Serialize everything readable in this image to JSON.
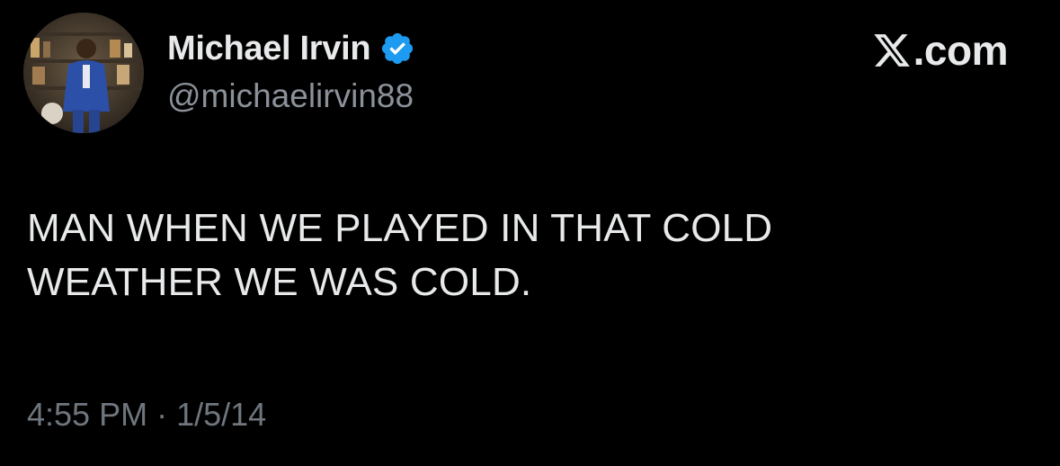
{
  "author": {
    "display_name": "Michael Irvin",
    "handle": "@michaelirvin88",
    "verified": true,
    "avatar_icon": "profile-photo-avatar"
  },
  "brand": {
    "icon": "x-logo-icon",
    "text": ".com"
  },
  "tweet": {
    "lines": [
      "MAN WHEN WE PLAYED IN THAT COLD",
      "WEATHER WE WAS COLD."
    ],
    "time": "4:55 PM",
    "separator": "·",
    "date": "1/5/14"
  },
  "colors": {
    "background": "#000000",
    "primary_text": "#e7e9ea",
    "secondary_text": "#8b9199",
    "timestamp_text": "#6f767d",
    "verified_blue": "#1d9bf0"
  }
}
